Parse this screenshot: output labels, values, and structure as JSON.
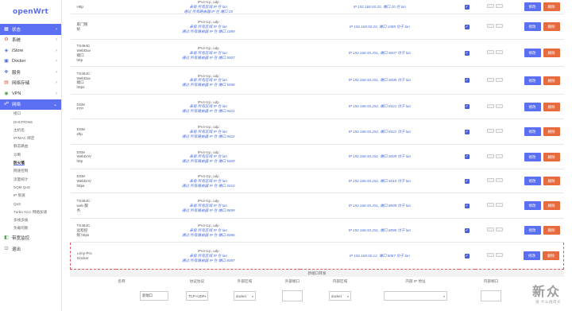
{
  "logo": "openWrt",
  "nav": [
    {
      "label": "状态",
      "icon": "status-icon",
      "state": "active"
    },
    {
      "label": "系统",
      "icon": "system-icon"
    },
    {
      "label": "iStore",
      "icon": "store-icon"
    },
    {
      "label": "Docker",
      "icon": "docker-icon"
    },
    {
      "label": "服务",
      "icon": "services-icon"
    },
    {
      "label": "网络存储",
      "icon": "storage-icon"
    },
    {
      "label": "VPN",
      "icon": "vpn-icon"
    },
    {
      "label": "网络",
      "icon": "network-icon",
      "state": "open"
    }
  ],
  "network_sub": [
    "接口",
    "DHCP/DNS",
    "主机名",
    "IP/MAC 绑定",
    "静态路由",
    "诊断",
    "防火墙",
    "网速控制",
    "流量统计",
    "SQM QoS",
    "IP 限速",
    "QoS",
    "Turbo ACC 网络加速",
    "多线多拨",
    "负载均衡"
  ],
  "nav_bottom": [
    {
      "label": "带宽监控",
      "icon": "bandwidth-icon"
    },
    {
      "label": "退出",
      "icon": "logout-icon"
    }
  ],
  "rules": [
    {
      "name": [
        "Http"
      ],
      "match": [
        "IPv4-tcp, udp",
        "来自 所有区域 IP 在 lan",
        "通过 所有路由器 IP 在 端口 20"
      ],
      "action": "IP 192.168.50.20, 端口 20 在 lan"
    },
    {
      "name": [
        "家门锁",
        "统"
      ],
      "match": [
        "IPv4-tcp, udp",
        "来自 所有区域 IP 在 lan",
        "通过 所有路由器 IP 在 端口 1089"
      ],
      "action": "IP 192.168.50.20, 端口 1089 位于 lan"
    },
    {
      "name": [
        "TS464C",
        "WebDav",
        "端口",
        "http"
      ],
      "match": [
        "IPv4-tcp, udp",
        "来自 所有区域 IP 在 lan",
        "通过 所有路由器 IP 在 端口 5007"
      ],
      "action": "IP 192.168.50.251, 端口 5007 位于 lan"
    },
    {
      "name": [
        "TS464C",
        "WebDav",
        "端口",
        "https"
      ],
      "match": [
        "IPv4-tcp, udp",
        "来自 所有区域 IP 在 lan",
        "通过 所有路由器 IP 在 端口 5008"
      ],
      "action": "IP 192.168.50.251, 端口 5008 位于 lan"
    },
    {
      "name": [
        "DSM",
        "FTP"
      ],
      "match": [
        "IPv4-tcp, udp",
        "来自 所有区域 IP 在 lan",
        "通过 所有路由器 IP 在 端口 8421"
      ],
      "action": "IP 192.168.50.252, 端口 8421 位于 lan"
    },
    {
      "name": [
        "DSM",
        "sftp"
      ],
      "match": [
        "IPv4-tcp, udp",
        "来自 所有区域 IP 在 lan",
        "通过 所有路由器 IP 在 端口 8422"
      ],
      "action": "IP 192.168.50.252, 端口 8422 位于 lan"
    },
    {
      "name": [
        "DSM",
        "WebDAV",
        "http"
      ],
      "match": [
        "IPv4-tcp, udp",
        "来自 所有区域 IP 在 lan",
        "通过 所有路由器 IP 在 端口 5009"
      ],
      "action": "IP 192.168.50.252, 端口 5009 位于 lan"
    },
    {
      "name": [
        "DSM",
        "WebDAV",
        "https"
      ],
      "match": [
        "IPv4-tcp, udp",
        "来自 所有区域 IP 在 lan",
        "通过 所有路由器 IP 在 端口 5010"
      ],
      "action": "IP 192.168.50.252, 端口 5010 位于 lan"
    },
    {
      "name": [
        "TS464C",
        "web 服",
        "务"
      ],
      "match": [
        "IPv4-tcp, udp",
        "来自 所有区域 IP 在 lan",
        "通过 所有路由器 IP 在 端口 8899"
      ],
      "action": "IP 192.168.50.251, 端口 8899 位于 lan"
    },
    {
      "name": [
        "TS464C",
        "远程控",
        "制 https"
      ],
      "match": [
        "IPv4-tcp, udp",
        "来自 所有区域 IP 在 lan",
        "通过 所有路由器 IP 在 端口 8086"
      ],
      "action": "IP 192.168.50.251, 端口 8086 位于 lan"
    },
    {
      "name": [
        "Lény-Pro",
        "Docker"
      ],
      "match": [
        "IPv4-tcp, udp",
        "来自 所有区域 IP 在 lan",
        "通过 所有路由器 IP 在 端口 8087"
      ],
      "action": "IP 192.168.50.12, 端口 8087 位于 lan",
      "highlight": true
    }
  ],
  "buttons": {
    "edit": "修改",
    "delete": "删除"
  },
  "new_rule": {
    "title": "新端口转发",
    "headers": [
      "名称",
      "协议协议",
      "外部区域",
      "外部端口",
      "内部区域",
      "内部 IP 地址",
      "内部端口"
    ],
    "name_value": "新端口",
    "protocol": "TCP+UDP",
    "ext_zone": "docker",
    "int_zone": "docker"
  },
  "watermark": {
    "main": "新众",
    "sub": "值 什么值得买"
  }
}
